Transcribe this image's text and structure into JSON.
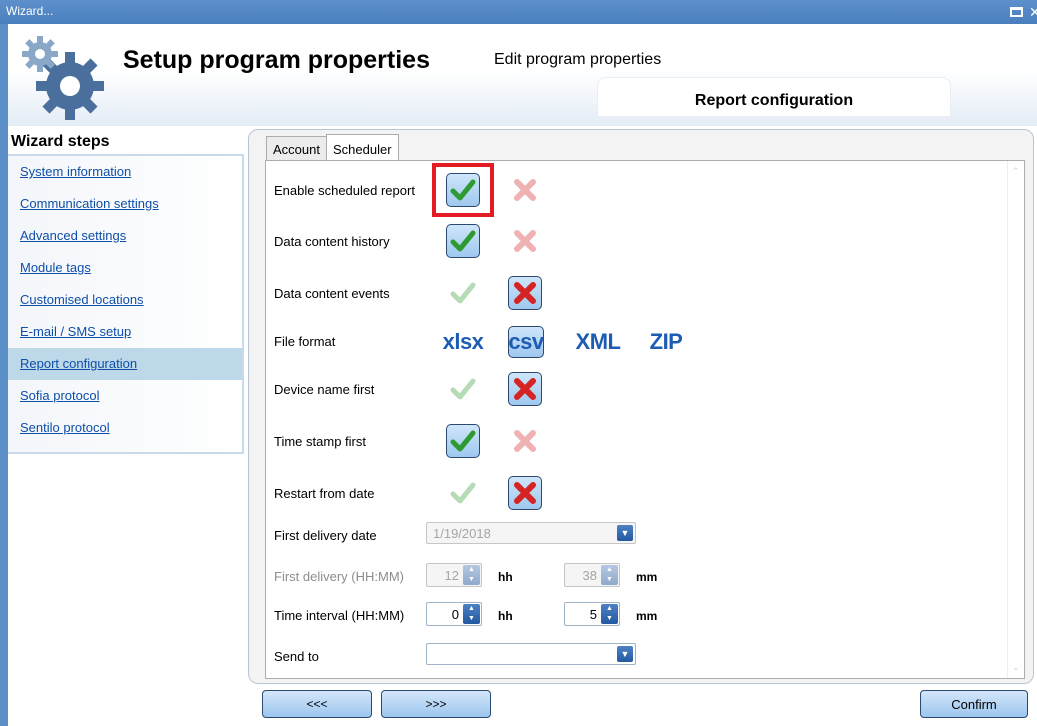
{
  "window": {
    "title": "Wizard..."
  },
  "header": {
    "title": "Setup program properties",
    "subtitle": "Edit program properties",
    "current_step": "Report configuration"
  },
  "sidebar": {
    "heading": "Wizard steps",
    "items": [
      {
        "label": "System information"
      },
      {
        "label": "Communication settings"
      },
      {
        "label": "Advanced settings"
      },
      {
        "label": "Module tags"
      },
      {
        "label": "Customised locations"
      },
      {
        "label": "E-mail / SMS setup"
      },
      {
        "label": "Report configuration",
        "active": true
      },
      {
        "label": "Sofia protocol"
      },
      {
        "label": "Sentilo protocol"
      }
    ]
  },
  "tabs": [
    {
      "label": "Account"
    },
    {
      "label": "Scheduler",
      "active": true
    }
  ],
  "scheduler": {
    "enable_scheduled_report": {
      "label": "Enable scheduled report",
      "value": true
    },
    "data_content_history": {
      "label": "Data content history",
      "value": true
    },
    "data_content_events": {
      "label": "Data content events",
      "value": false
    },
    "file_format": {
      "label": "File format",
      "options": [
        "xlsx",
        "csv",
        "XML",
        "ZIP"
      ],
      "selected": "csv"
    },
    "device_name_first": {
      "label": "Device name first",
      "value": false
    },
    "time_stamp_first": {
      "label": "Time stamp first",
      "value": true
    },
    "restart_from_date": {
      "label": "Restart from date",
      "value": false
    },
    "first_delivery_date": {
      "label": "First delivery date",
      "value": "1/19/2018"
    },
    "first_delivery_time": {
      "label": "First delivery (HH:MM)",
      "hh": "12",
      "mm": "38",
      "hh_unit": "hh",
      "mm_unit": "mm"
    },
    "time_interval": {
      "label": "Time interval (HH:MM)",
      "hh": "0",
      "mm": "5",
      "hh_unit": "hh",
      "mm_unit": "mm"
    },
    "send_to": {
      "label": "Send to",
      "value": ""
    }
  },
  "nav": {
    "prev_label": "<<<",
    "next_label": ">>>",
    "confirm_label": "Confirm"
  },
  "colors": {
    "accent": "#5b8fc7",
    "link": "#0f4fa8",
    "highlight": "#e51b24",
    "check_green": "#3aa13a",
    "cross_red": "#d42424"
  }
}
